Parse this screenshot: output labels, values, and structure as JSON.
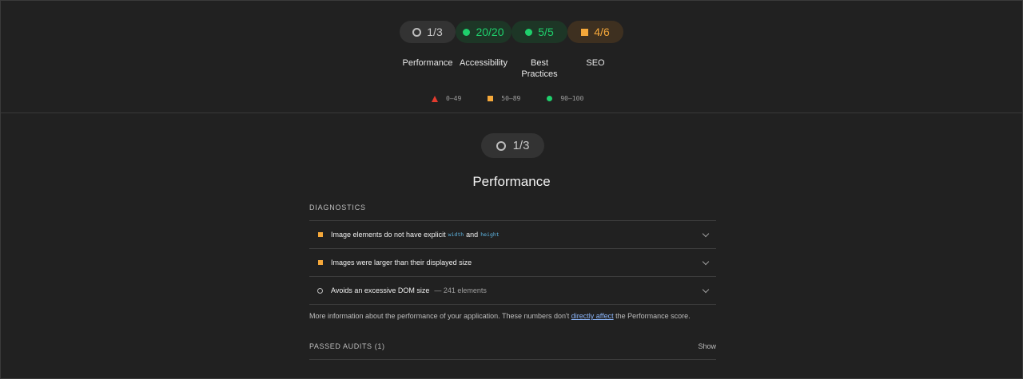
{
  "summary": {
    "categories": [
      {
        "score": "1/3",
        "label": "Performance",
        "status": "neutral"
      },
      {
        "score": "20/20",
        "label": "Accessibility",
        "status": "pass"
      },
      {
        "score": "5/5",
        "label": "Best Practices",
        "status": "pass"
      },
      {
        "score": "4/6",
        "label": "SEO",
        "status": "average"
      }
    ],
    "legend": [
      {
        "range": "0–49",
        "shape": "triangle",
        "color": "#e33b2e"
      },
      {
        "range": "50–89",
        "shape": "square",
        "color": "#f5a83a"
      },
      {
        "range": "90–100",
        "shape": "circle",
        "color": "#1fcf6c"
      }
    ]
  },
  "category": {
    "score": "1/3",
    "title": "Performance",
    "diagnostics_heading": "DIAGNOSTICS",
    "audits": [
      {
        "text_before": "Image elements do not have explicit",
        "code1": "width",
        "text_mid": "and",
        "code2": "height",
        "status": "average"
      },
      {
        "text": "Images were larger than their displayed size",
        "status": "average"
      },
      {
        "text": "Avoids an excessive DOM size",
        "display_value": "— 241 elements",
        "status": "neutral"
      }
    ],
    "info_before": "More information about the performance of your application. These numbers don't",
    "info_link": "directly affect",
    "info_after": "the Performance score.",
    "passed_heading": "PASSED AUDITS (1)",
    "show_label": "Show"
  },
  "colors": {
    "background": "#212121",
    "pass": "#1fcf6c",
    "average": "#f5a83a",
    "fail": "#e33b2e",
    "link": "#8ab4f8"
  }
}
